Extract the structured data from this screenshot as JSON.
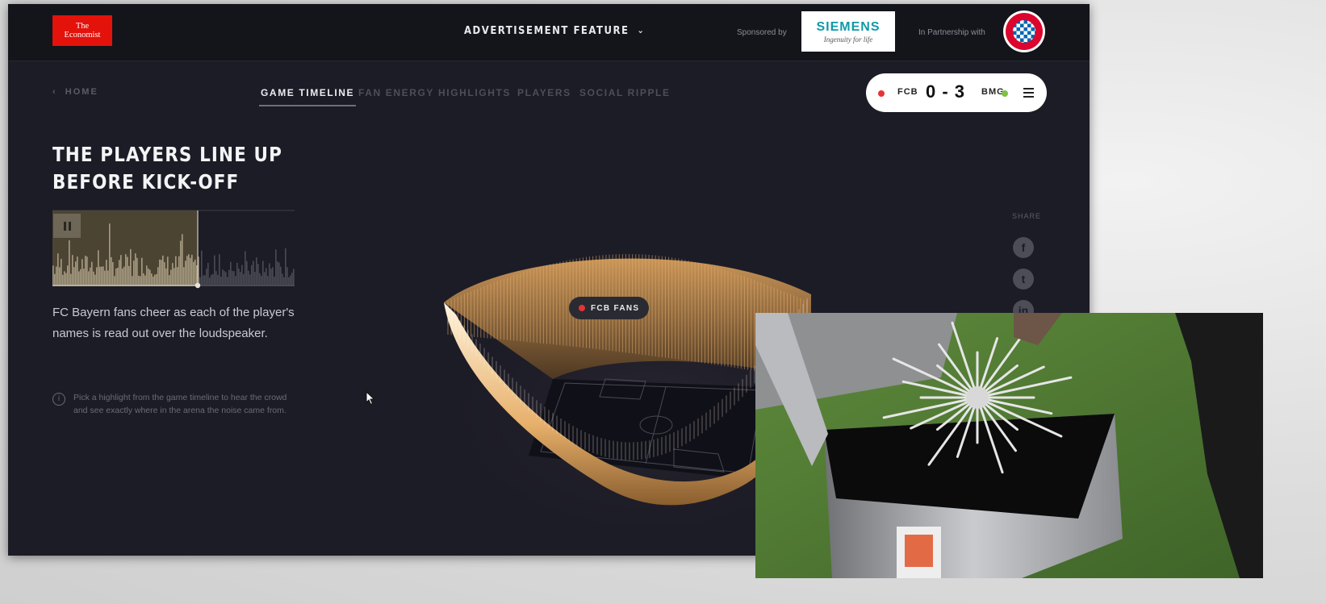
{
  "header": {
    "logo_line1": "The",
    "logo_line2": "Economist",
    "feature_label": "ADVERTISEMENT FEATURE",
    "sponsored_label": "Sponsored by",
    "sponsor_name": "SIEMENS",
    "sponsor_tagline": "Ingenuity for life",
    "partner_label": "In Partnership with"
  },
  "nav": {
    "home": "HOME",
    "tabs": [
      {
        "label": "GAME TIMELINE",
        "active": true
      },
      {
        "label": "FAN ENERGY",
        "active": false
      },
      {
        "label": "HIGHLIGHTS",
        "active": false
      },
      {
        "label": "PLAYERS",
        "active": false
      },
      {
        "label": "SOCIAL RIPPLE",
        "active": false
      }
    ]
  },
  "scoreboard": {
    "home_team": "FCB",
    "away_team": "BMG",
    "score": "0 - 3",
    "home_color": "#e53434",
    "away_color": "#7dc142"
  },
  "moment": {
    "title_line1": "THE PLAYERS LINE UP",
    "title_line2": "BEFORE KICK-OFF",
    "timeline_progress": 0.6,
    "description": "FC Bayern fans cheer as each of the player's names is read out over the loudspeaker.",
    "hint": "Pick a highlight from the game timeline to hear the crowd and see exactly where in the arena the noise came from."
  },
  "share": {
    "label": "SHARE",
    "icons": [
      "facebook-icon",
      "twitter-icon",
      "linkedin-icon"
    ]
  },
  "stadium": {
    "tag_label": "FCB FANS"
  },
  "colors": {
    "background": "#1c1c26",
    "accent": "#e3120b",
    "glow": "#f5c98a"
  }
}
